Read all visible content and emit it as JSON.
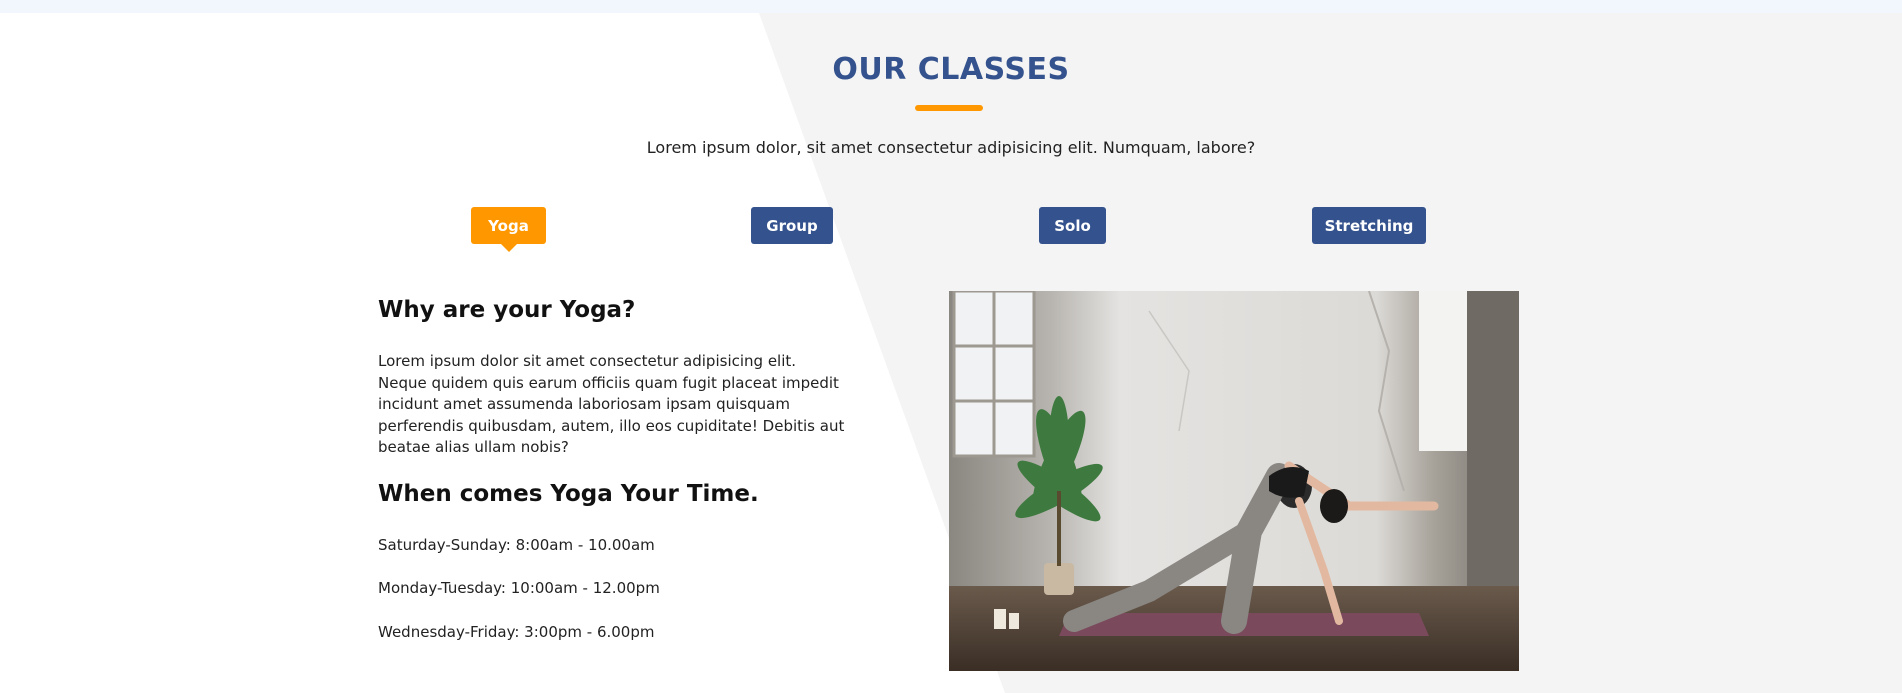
{
  "section": {
    "title": "OUR CLASSES",
    "subtitle": "Lorem ipsum dolor, sit amet consectetur adipisicing elit. Numquam, labore?",
    "accent_color": "#ff9800",
    "primary_color": "#34528d"
  },
  "tabs": [
    {
      "label": "Yoga",
      "active": true
    },
    {
      "label": "Group",
      "active": false
    },
    {
      "label": "Solo",
      "active": false
    },
    {
      "label": "Stretching",
      "active": false
    }
  ],
  "content": {
    "heading_1": "Why are your Yoga?",
    "paragraph": "Lorem ipsum dolor sit amet consectetur adipisicing elit. Neque quidem quis earum officiis quam fugit placeat impedit incidunt amet assumenda laboriosam ipsam quisquam perferendis quibusdam, autem, illo eos cupiditate! Debitis aut beatae alias ullam nobis?",
    "heading_2": "When comes Yoga Your Time.",
    "schedule": [
      "Saturday-Sunday: 8:00am - 10.00am",
      "Monday-Tuesday: 10:00am - 12.00pm",
      "Wednesday-Friday: 3:00pm - 6.00pm"
    ]
  },
  "image": {
    "subject": "woman-doing-yoga-stretch-photo"
  }
}
